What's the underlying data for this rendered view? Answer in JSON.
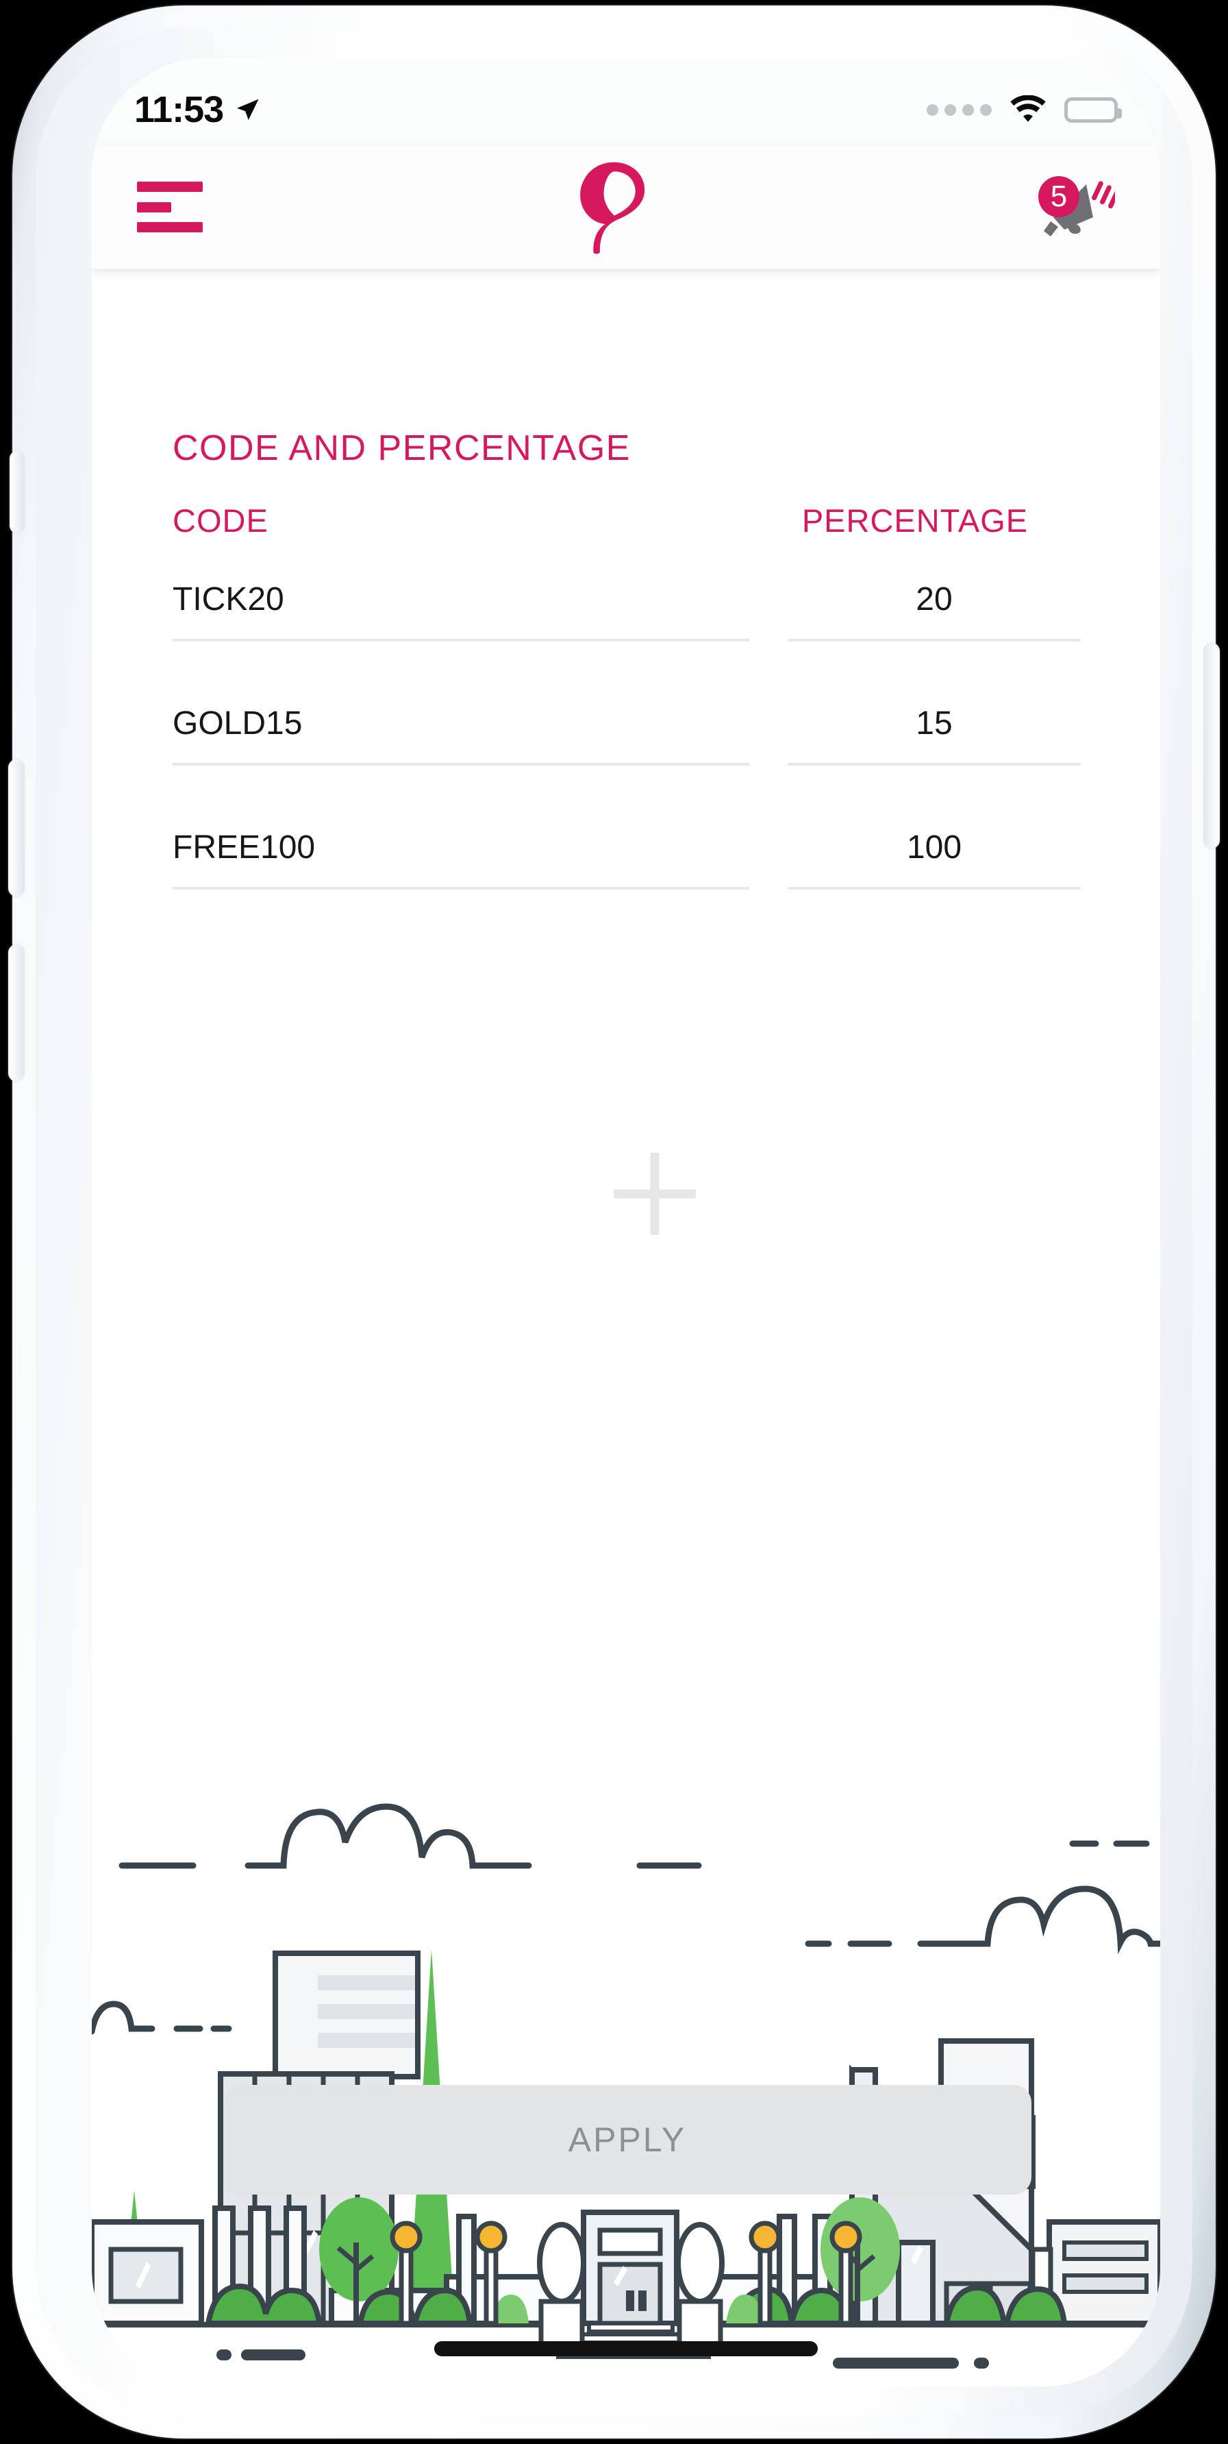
{
  "theme": {
    "brand_crimson": "#D6195C",
    "text_dark": "#171717",
    "divider_grey": "#E6E8EA",
    "button_grey": "#E2E4E5",
    "button_text_grey": "#8D9093",
    "illustration_outline": "#39444D",
    "illustration_fill": "#E6E9EB",
    "tree_green": "#5CBE53",
    "lamp_yellow": "#F5B731"
  },
  "status_bar": {
    "time": "11:53",
    "location_icon": "location-arrow-icon",
    "signal_icon": "signal-dots-icon",
    "signal_dots": 4,
    "wifi_icon": "wifi-icon",
    "battery_icon": "battery-full-icon"
  },
  "header": {
    "menu_icon": "hamburger-menu-icon",
    "logo_icon": "app-logo-icon",
    "notification_icon": "megaphone-icon",
    "notification_count": "5"
  },
  "main": {
    "section_title": "CODE AND PERCENTAGE",
    "table": {
      "columns": [
        "CODE",
        "PERCENTAGE"
      ],
      "rows": [
        {
          "code": "TICK20",
          "percentage": "20"
        },
        {
          "code": "GOLD15",
          "percentage": "15"
        },
        {
          "code": "FREE100",
          "percentage": "100"
        }
      ]
    },
    "add_row_icon": "plus-icon"
  },
  "footer": {
    "apply_label": "APPLY",
    "illustration": "city-skyline-illustration",
    "home_indicator": "home-indicator-bar"
  }
}
